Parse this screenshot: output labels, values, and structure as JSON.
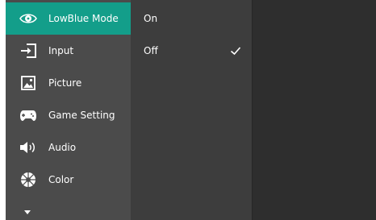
{
  "menu": {
    "items": [
      {
        "label": "LowBlue Mode",
        "icon": "eye-icon",
        "active": true
      },
      {
        "label": "Input",
        "icon": "input-arrow-icon"
      },
      {
        "label": "Picture",
        "icon": "picture-icon"
      },
      {
        "label": "Game Setting",
        "icon": "gamepad-icon"
      },
      {
        "label": "Audio",
        "icon": "speaker-icon"
      },
      {
        "label": "Color",
        "icon": "color-wheel-icon"
      }
    ],
    "more_icon": "chevron-down-icon"
  },
  "submenu": {
    "options": [
      {
        "label": "On",
        "selected": false
      },
      {
        "label": "Off",
        "selected": true
      }
    ]
  },
  "colors": {
    "accent": "#139e8a",
    "menu_bg": "#4b4b4b",
    "submenu_bg": "#3d3d3d",
    "detail_bg": "#2e2e2e"
  }
}
